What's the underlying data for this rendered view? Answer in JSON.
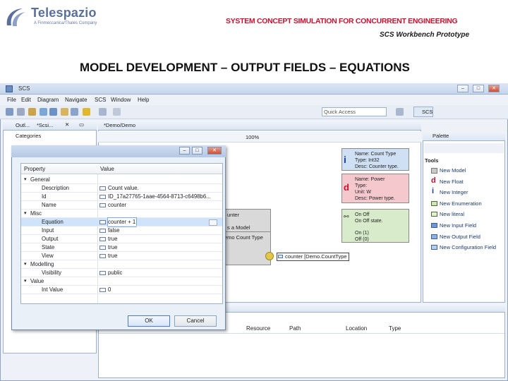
{
  "slide": {
    "logo_name": "Telespazio",
    "logo_tagline": "A Finmeccanica/Thales Company",
    "title": "SYSTEM CONCEPT SIMULATION FOR CONCURRENT ENGINEERING",
    "subtitle": "SCS Workbench Prototype",
    "heading": "MODEL DEVELOPMENT – OUTPUT FIELDS – EQUATIONS"
  },
  "window": {
    "title": "SCS",
    "menu": [
      "File",
      "Edit",
      "Diagram",
      "Navigate",
      "SCS",
      "Window",
      "Help"
    ],
    "quick_access": "Quick Access",
    "perspective": "SCS"
  },
  "outline": {
    "tab": "Outl...",
    "tab2": "*Scsi...",
    "tree_item": "Categories"
  },
  "editor": {
    "tab": "*Demo/Demo",
    "zoom": "100%",
    "class_partial_1": "unter",
    "class_partial_2": "s a Model",
    "class_partial_3": "emo Count Type",
    "field_label": "counter [Demo.CountType"
  },
  "notes": {
    "blue": [
      "Name: Count Type",
      "Type: Int32",
      "Desc: Counter type."
    ],
    "red": [
      "Name: Power",
      "Type:",
      "Unit: W",
      "Desc: Power type."
    ],
    "green": [
      "On Off",
      "On Off state.",
      "On (1)",
      "Off (0)"
    ]
  },
  "palette": {
    "title": "Palette",
    "section": "Tools",
    "items": [
      "New Model",
      "New Float",
      "New Integer",
      "New Enumeration",
      "New literal",
      "New Input Field",
      "New Output Field",
      "New Configuration Field"
    ]
  },
  "dialog": {
    "header_property": "Property",
    "header_value": "Value",
    "rows": [
      {
        "indent": 0,
        "expander": "▾",
        "property": "General",
        "value": "",
        "icon": false
      },
      {
        "indent": 1,
        "expander": "",
        "property": "Description",
        "value": "Count value.",
        "icon": true
      },
      {
        "indent": 1,
        "expander": "",
        "property": "Id",
        "value": "ID_17a27765-1aae-4564-8713-c6498b6...",
        "icon": true
      },
      {
        "indent": 1,
        "expander": "",
        "property": "Name",
        "value": "counter",
        "icon": true
      },
      {
        "indent": 0,
        "expander": "▾",
        "property": "Misc",
        "value": "",
        "icon": false
      },
      {
        "indent": 1,
        "expander": "",
        "property": "Equation",
        "value": "counter + 1",
        "icon": true,
        "selected": true
      },
      {
        "indent": 1,
        "expander": "",
        "property": "Input",
        "value": "false",
        "icon": true
      },
      {
        "indent": 1,
        "expander": "",
        "property": "Output",
        "value": "true",
        "icon": true
      },
      {
        "indent": 1,
        "expander": "",
        "property": "State",
        "value": "true",
        "icon": true
      },
      {
        "indent": 1,
        "expander": "",
        "property": "View",
        "value": "true",
        "icon": true
      },
      {
        "indent": 0,
        "expander": "▾",
        "property": "Modelling",
        "value": "",
        "icon": false
      },
      {
        "indent": 1,
        "expander": "",
        "property": "Visibility",
        "value": "public",
        "icon": true
      },
      {
        "indent": 0,
        "expander": "▾",
        "property": "Value",
        "value": "",
        "icon": false
      },
      {
        "indent": 1,
        "expander": "",
        "property": "Int Value",
        "value": "0",
        "icon": true
      }
    ],
    "ok": "OK",
    "cancel": "Cancel"
  },
  "problems": {
    "columns": [
      "Resource",
      "Path",
      "Location",
      "Type"
    ]
  },
  "colors": {
    "title_red": "#c8102e",
    "window_border": "#8ea3c4",
    "note_blue": "#cfe0f4",
    "note_red": "#f4c8cc",
    "note_green": "#d8eccb"
  }
}
